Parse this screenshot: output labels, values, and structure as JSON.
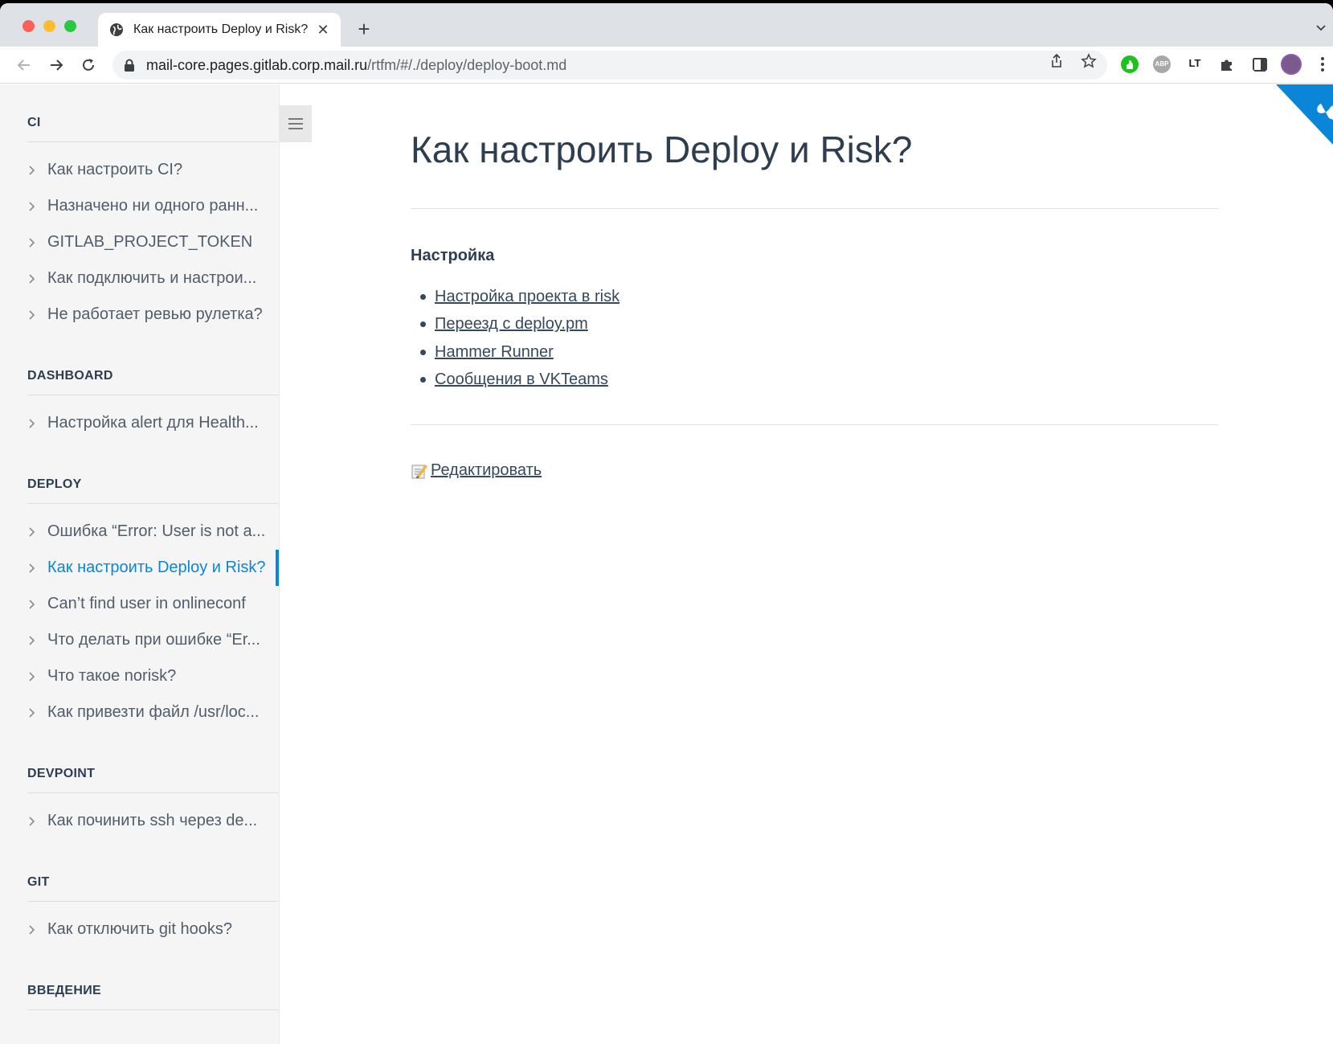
{
  "browser": {
    "tab_title": "Как настроить Deploy и Risk?",
    "tab_close": "✕",
    "new_tab": "+",
    "url_host": "mail-core.pages.gitlab.corp.mail.ru",
    "url_path": "/rtfm/#/./deploy/deploy-boot.md",
    "ext_abp_label": "ABP",
    "ext_lt_label": "LT"
  },
  "sidebar": {
    "sections": [
      {
        "title": "CI",
        "items": [
          "Как настроить CI?",
          "Назначено ни одного ранн...",
          "GITLAB_PROJECT_TOKEN",
          "Как подключить и настрои...",
          "Не работает ревью рулетка?"
        ]
      },
      {
        "title": "DASHBOARD",
        "items": [
          "Настройка alert для Health..."
        ]
      },
      {
        "title": "DEPLOY",
        "items": [
          "Ошибка “Error: User is not a...",
          "Как настроить Deploy и Risk?",
          "Can’t find user in onlineconf",
          "Что делать при ошибке “Er...",
          "Что такое norisk?",
          "Как привезти файл /usr/loc..."
        ]
      },
      {
        "title": "DEVPOINT",
        "items": [
          "Как починить ssh через de..."
        ]
      },
      {
        "title": "GIT",
        "items": [
          "Как отключить git hooks?"
        ]
      },
      {
        "title": "ВВЕДЕНИЕ",
        "items": []
      }
    ]
  },
  "content": {
    "title": "Как настроить Deploy и Risk?",
    "section_heading": "Настройка",
    "links": [
      "Настройка проекта в risk",
      "Переезд с deploy.pm",
      "Hammer Runner",
      "Сообщения в VKTeams"
    ],
    "edit_label": "Редактировать"
  },
  "colors": {
    "accent": "#0b85d8",
    "text": "#2c3e50",
    "sidebar_bg": "#f5f5f5"
  }
}
